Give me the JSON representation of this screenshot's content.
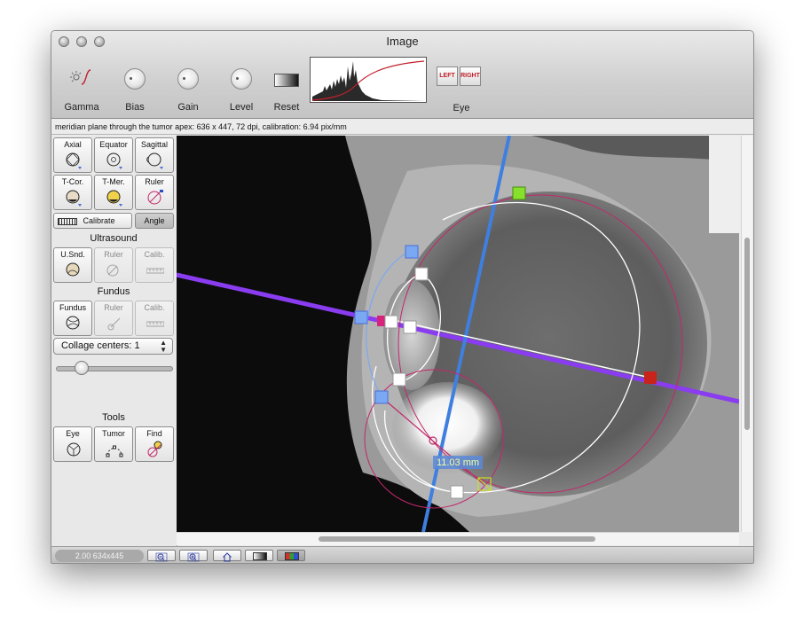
{
  "window": {
    "title": "Image"
  },
  "toolbar": {
    "gamma_label": "Gamma",
    "bias_label": "Bias",
    "gain_label": "Gain",
    "level_label": "Level",
    "reset_label": "Reset",
    "eye_label": "Eye",
    "eye_left_label": "LEFT",
    "eye_right_label": "RIGHT"
  },
  "info": {
    "text": "meridian plane through the tumor apex: 636 x 447, 72 dpi, calibration: 6.94 pix/mm"
  },
  "sidebar": {
    "views": {
      "axial": "Axial",
      "equator": "Equator",
      "sagittal": "Sagittal",
      "tcor": "T-Cor.",
      "tmer": "T-Mer.",
      "ruler": "Ruler"
    },
    "calibrate_label": "Calibrate",
    "angle_label": "Angle",
    "ultrasound": {
      "title": "Ultrasound",
      "usnd": "U.Snd.",
      "ruler": "Ruler",
      "calib": "Calib."
    },
    "fundus": {
      "title": "Fundus",
      "fundus": "Fundus",
      "ruler": "Ruler",
      "calib": "Calib."
    },
    "collage": {
      "label": "Collage centers: 1",
      "slider_fraction": 0.15
    },
    "tools": {
      "title": "Tools",
      "eye": "Eye",
      "tumor": "Tumor",
      "find": "Find"
    }
  },
  "image": {
    "measurement_label": "11.03 mm"
  },
  "status": {
    "zoom_text": "2.00 634x445"
  },
  "colors": {
    "meridian_line": "#8a3cf0",
    "axis_line": "#3f7fe0",
    "contour": "#c2286a",
    "apex_marker": "#c8241c",
    "top_marker": "#86e02c",
    "handle_blue": "#7aa8f2"
  }
}
